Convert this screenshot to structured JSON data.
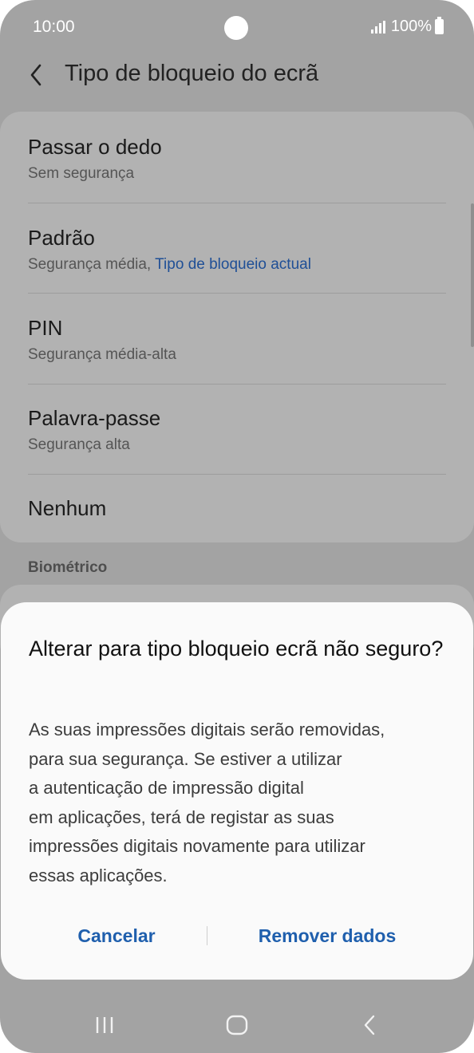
{
  "status_bar": {
    "time": "10:00",
    "battery": "100%"
  },
  "header": {
    "title": "Tipo de bloqueio do ecrã",
    "back_icon": "back-arrow-icon"
  },
  "options": [
    {
      "title": "Passar o dedo",
      "subtitle": "Sem segurança"
    },
    {
      "title": "Padrão",
      "subtitle": "Segurança média, ",
      "subtitle_accent": "Tipo de bloqueio actual"
    },
    {
      "title": "PIN",
      "subtitle": "Segurança média-alta"
    },
    {
      "title": "Palavra-passe",
      "subtitle": "Segurança alta"
    },
    {
      "title": "Nenhum"
    }
  ],
  "section_label": "Biométrico",
  "dialog": {
    "title": "Alterar para tipo bloqueio ecrã não seguro?",
    "body_lines": [
      "As suas impressões digitais serão removidas,",
      "para sua segurança. Se estiver a utilizar",
      "a autenticação de impressão digital",
      "em aplicações, terá de registar as suas",
      "impressões digitais novamente para utilizar",
      "essas aplicações."
    ],
    "cancel_label": "Cancelar",
    "confirm_label": "Remover dados"
  },
  "nav_bar": {
    "icons": [
      "recent-apps-icon",
      "home-icon",
      "back-icon"
    ]
  },
  "colors": {
    "accent": "#1f5fad",
    "scrim": "#a3a3a3",
    "dialog_bg": "#fafafa"
  }
}
